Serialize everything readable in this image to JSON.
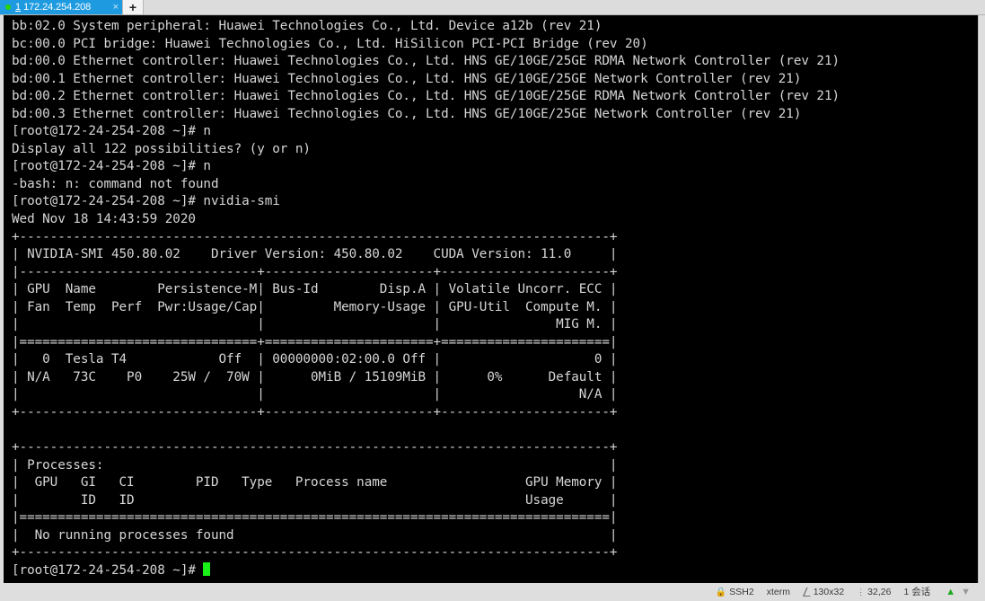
{
  "window": {
    "background": "#dedede",
    "terminal_bg": "#000000",
    "terminal_fg": "#d6d6d6",
    "accent": "#1e9be0",
    "cursor_color": "#18f218"
  },
  "tab_bar": {
    "tabs": [
      {
        "index": "1",
        "title": "172.24.254.208",
        "status_dot": "connected-dot",
        "close_label": "×",
        "active": true
      }
    ],
    "new_tab_label": "+"
  },
  "terminal": {
    "lines": [
      "bb:02.0 System peripheral: Huawei Technologies Co., Ltd. Device a12b (rev 21)",
      "bc:00.0 PCI bridge: Huawei Technologies Co., Ltd. HiSilicon PCI-PCI Bridge (rev 20)",
      "bd:00.0 Ethernet controller: Huawei Technologies Co., Ltd. HNS GE/10GE/25GE RDMA Network Controller (rev 21)",
      "bd:00.1 Ethernet controller: Huawei Technologies Co., Ltd. HNS GE/10GE/25GE Network Controller (rev 21)",
      "bd:00.2 Ethernet controller: Huawei Technologies Co., Ltd. HNS GE/10GE/25GE RDMA Network Controller (rev 21)",
      "bd:00.3 Ethernet controller: Huawei Technologies Co., Ltd. HNS GE/10GE/25GE Network Controller (rev 21)",
      "[root@172-24-254-208 ~]# n",
      "Display all 122 possibilities? (y or n)",
      "[root@172-24-254-208 ~]# n",
      "-bash: n: command not found",
      "[root@172-24-254-208 ~]# nvidia-smi",
      "Wed Nov 18 14:43:59 2020",
      "+-----------------------------------------------------------------------------+",
      "| NVIDIA-SMI 450.80.02    Driver Version: 450.80.02    CUDA Version: 11.0     |",
      "|-------------------------------+----------------------+----------------------+",
      "| GPU  Name        Persistence-M| Bus-Id        Disp.A | Volatile Uncorr. ECC |",
      "| Fan  Temp  Perf  Pwr:Usage/Cap|         Memory-Usage | GPU-Util  Compute M. |",
      "|                               |                      |               MIG M. |",
      "|===============================+======================+======================|",
      "|   0  Tesla T4            Off  | 00000000:02:00.0 Off |                    0 |",
      "| N/A   73C    P0    25W /  70W |      0MiB / 15109MiB |      0%      Default |",
      "|                               |                      |                  N/A |",
      "+-------------------------------+----------------------+----------------------+",
      "",
      "+-----------------------------------------------------------------------------+",
      "| Processes:                                                                  |",
      "|  GPU   GI   CI        PID   Type   Process name                  GPU Memory |",
      "|        ID   ID                                                   Usage      |",
      "|=============================================================================|",
      "|  No running processes found                                                 |",
      "+-----------------------------------------------------------------------------+",
      "[root@172-24-254-208 ~]# "
    ],
    "prompt": "[root@172-24-254-208 ~]# ",
    "cursor_visible": true,
    "nvidia_smi": {
      "timestamp": "Wed Nov 18 14:43:59 2020",
      "smi_version": "450.80.02",
      "driver_version": "450.80.02",
      "cuda_version": "11.0",
      "column_headers_row1": [
        "GPU",
        "Name",
        "Persistence-M",
        "Bus-Id",
        "Disp.A",
        "Volatile Uncorr. ECC"
      ],
      "column_headers_row2": [
        "Fan",
        "Temp",
        "Perf",
        "Pwr:Usage/Cap",
        "Memory-Usage",
        "GPU-Util",
        "Compute M."
      ],
      "column_headers_row3": [
        "MIG M."
      ],
      "gpus": [
        {
          "id": "0",
          "name": "Tesla T4",
          "persistence_m": "Off",
          "bus_id": "00000000:02:00.0",
          "disp_a": "Off",
          "ecc": "0",
          "fan": "N/A",
          "temp": "73C",
          "perf": "P0",
          "pwr_usage_cap": "25W /  70W",
          "memory_usage": "0MiB / 15109MiB",
          "gpu_util": "0%",
          "compute_m": "Default",
          "mig_m": "N/A"
        }
      ],
      "processes": {
        "section_label": "Processes:",
        "headers": [
          "GPU",
          "GI ID",
          "CI ID",
          "PID",
          "Type",
          "Process name",
          "GPU Memory Usage"
        ],
        "empty_message": "No running processes found"
      }
    }
  },
  "status_bar": {
    "ssh_protocol": "SSH2",
    "terminal_type": "xterm",
    "dimensions": "130x32",
    "cursor_position": "32,26",
    "sessions": "1 会话",
    "upload_icon": "▲",
    "download_icon": "▼"
  }
}
